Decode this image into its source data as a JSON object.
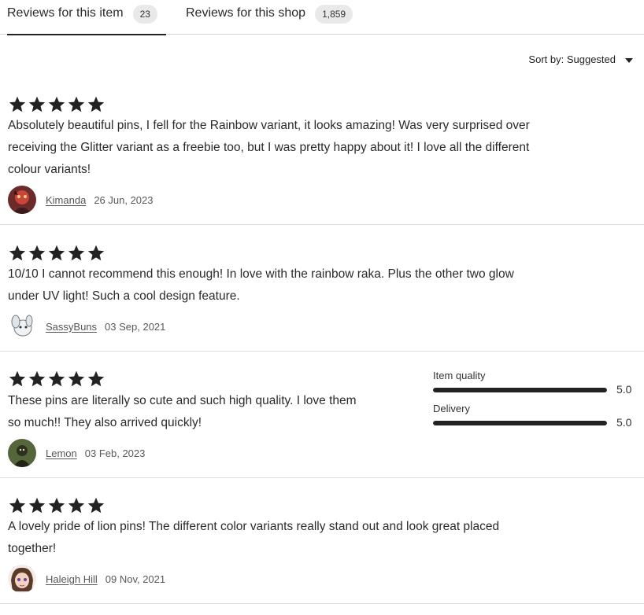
{
  "tabs": [
    {
      "label": "Reviews for this item",
      "count": "23",
      "active": true
    },
    {
      "label": "Reviews for this shop",
      "count": "1,859",
      "active": false
    }
  ],
  "sort": {
    "label": "Sort by: Suggested"
  },
  "reviews": [
    {
      "rating": 5,
      "text_lines": [
        "Absolutely beautiful pins, I fell for the Rainbow variant, it looks amazing! Was very surprised over",
        "receiving the Glitter variant as a freebie too, but I was pretty happy about it! I love all the different",
        "colour variants!"
      ],
      "reviewer": "Kimanda",
      "date": "26 Jun, 2023"
    },
    {
      "rating": 5,
      "text_lines": [
        "10/10 I cannot recommend this enough! In love with the rainbow raka. Plus the other two glow",
        "under UV light! Such a cool design feature."
      ],
      "reviewer": "SassyBuns",
      "date": "03 Sep, 2021"
    },
    {
      "rating": 5,
      "text_lines": [
        "These pins are literally so cute and such high quality. I love them",
        "so much!! They also arrived quickly!"
      ],
      "reviewer": "Lemon",
      "date": "03 Feb, 2023",
      "sub_ratings": [
        {
          "name": "Item quality",
          "value": "5.0",
          "fraction": 1.0
        },
        {
          "name": "Delivery",
          "value": "5.0",
          "fraction": 1.0
        }
      ]
    },
    {
      "rating": 5,
      "text_lines": [
        "A lovely pride of lion pins! The different color variants really stand out and look great placed",
        "together!"
      ],
      "reviewer": "Haleigh Hill",
      "date": "09 Nov, 2021"
    }
  ],
  "colors": {
    "star": "#222222",
    "divider": "#dcdcdc",
    "bar_fill": "#222222"
  },
  "icons": {
    "star": "star-icon",
    "sort_caret": "caret-down-icon"
  }
}
